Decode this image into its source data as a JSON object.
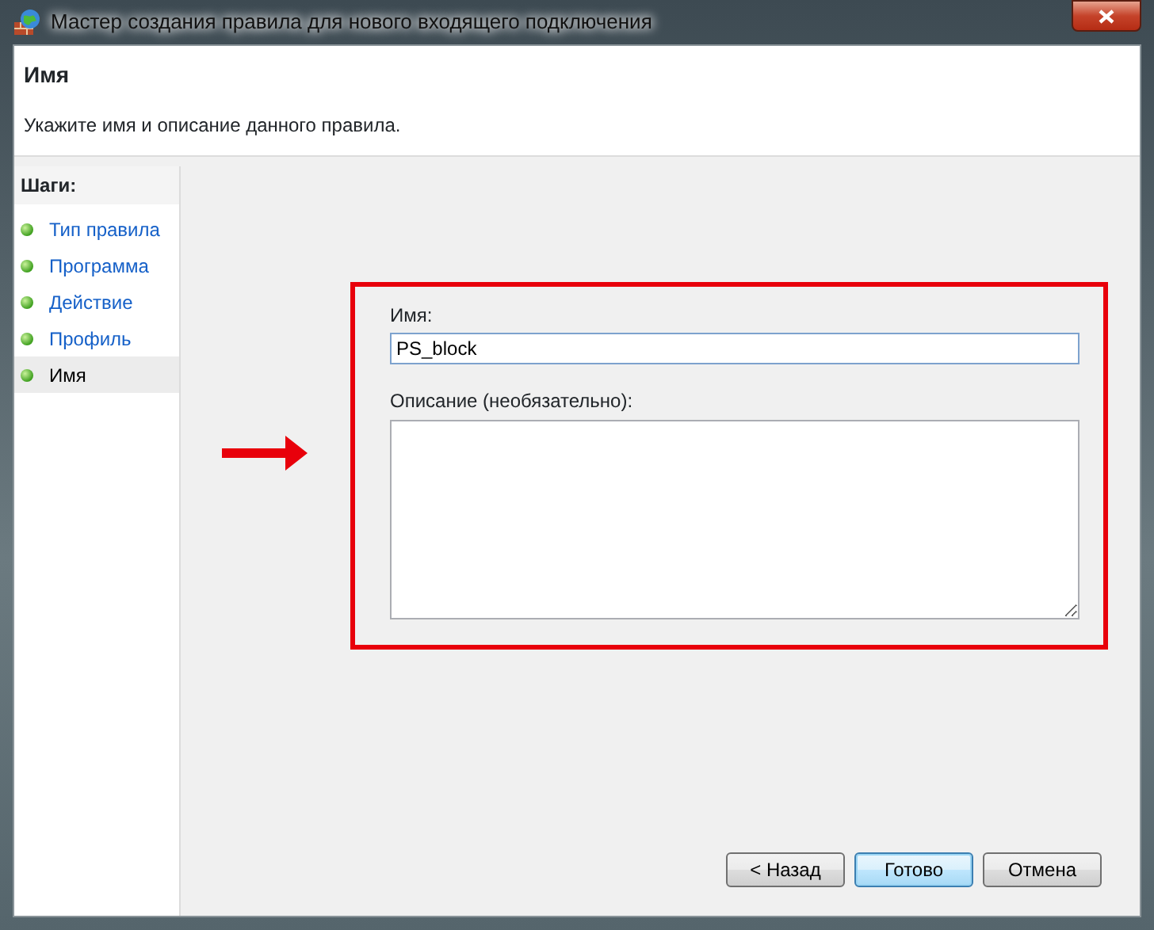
{
  "window": {
    "title": "Мастер создания правила для нового входящего подключения"
  },
  "header": {
    "title": "Имя",
    "subtitle": "Укажите имя и описание данного правила."
  },
  "steps": {
    "title": "Шаги:",
    "items": [
      {
        "label": "Тип правила",
        "selected": false
      },
      {
        "label": "Программа",
        "selected": false
      },
      {
        "label": "Действие",
        "selected": false
      },
      {
        "label": "Профиль",
        "selected": false
      },
      {
        "label": "Имя",
        "selected": true
      }
    ]
  },
  "form": {
    "name_label": "Имя:",
    "name_value": "PS_block",
    "description_label": "Описание (необязательно):"
  },
  "buttons": [
    {
      "label": "< Назад",
      "default": false
    },
    {
      "label": "Готово",
      "default": true
    },
    {
      "label": "Отмена",
      "default": false
    }
  ]
}
